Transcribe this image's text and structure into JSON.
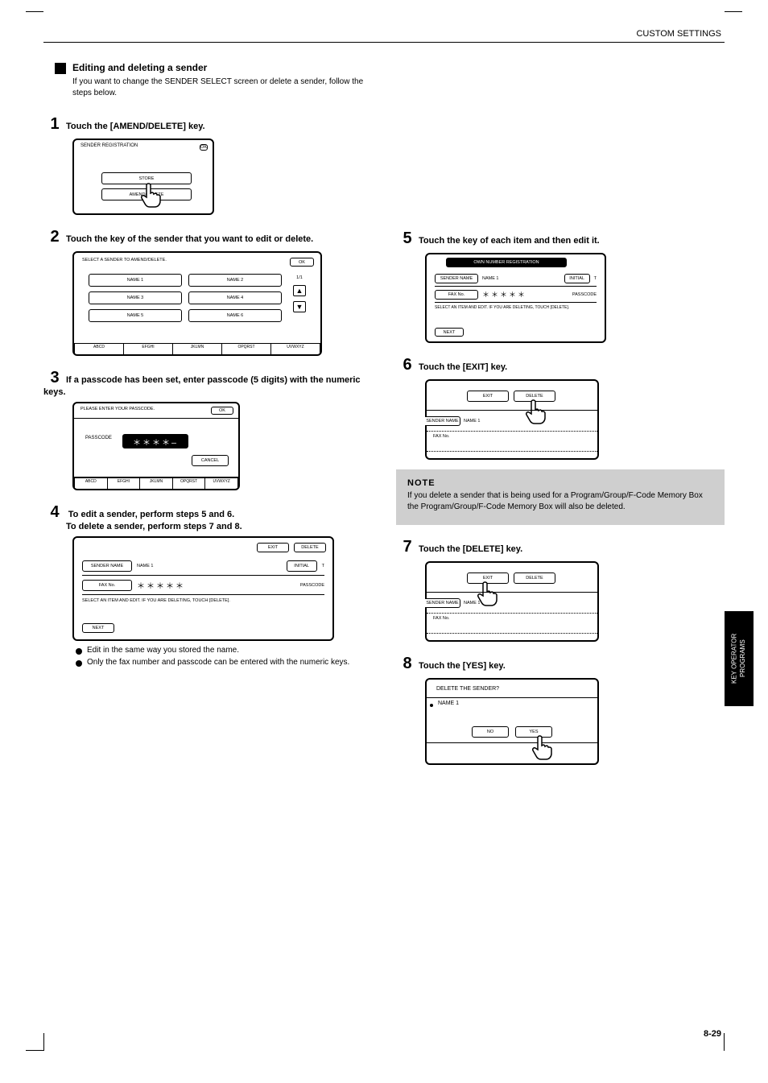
{
  "header": {
    "breadcrumb": "CUSTOM SETTINGS"
  },
  "side_tab": "KEY OPERATOR PROGRAMS",
  "footer_page": "8-29",
  "section": {
    "title": "Editing and deleting a sender",
    "intro": "If you want to change the SENDER SELECT screen or delete a sender, follow the steps below."
  },
  "steps": {
    "s1": {
      "num": "1",
      "txt": "Touch the [AMEND/DELETE] key."
    },
    "s2": {
      "num": "2",
      "txt": "Touch the key of the sender that you want to edit or delete."
    },
    "s3": {
      "num": "3",
      "txt": "If a passcode has been set, enter passcode (5 digits) with the numeric keys."
    },
    "s4_a": {
      "num": "4",
      "txt_a": "To edit a sender, perform steps 5 and 6.",
      "txt_b": "To delete a sender, perform steps 7 and 8."
    },
    "s5": {
      "num": "5",
      "txt": "Touch the key of each item and then edit it."
    },
    "s6": {
      "num": "6",
      "txt": "Touch the [EXIT] key."
    },
    "s7": {
      "num": "7",
      "txt": "Touch the [DELETE] key."
    },
    "s8": {
      "num": "8",
      "txt": "Touch the [YES] key."
    }
  },
  "panel1": {
    "ok": "OK",
    "row_label": "SENDER REGISTRATION",
    "opt1": "STORE",
    "opt2": "AMEND/DELETE"
  },
  "panel2": {
    "ok": "OK",
    "hint_top": "SELECT A SENDER TO AMEND/DELETE.",
    "items": [
      "NAME 1",
      "NAME 2",
      "NAME 3",
      "NAME 4",
      "NAME 5",
      "NAME 6"
    ],
    "page": "1/1",
    "tabs": [
      "ABCD",
      "EFGHI",
      "JKLMN",
      "OPQRST",
      "UVWXYZ"
    ]
  },
  "panel3": {
    "ok": "OK",
    "title": "PLEASE ENTER YOUR PASSCODE.",
    "passcode_label": "PASSCODE",
    "passcode_mask": "＊＊＊＊—",
    "cancel": "CANCEL",
    "tabs": [
      "ABCD",
      "EFGHI",
      "JKLMN",
      "OPQRST",
      "UVWXYZ"
    ]
  },
  "panel4": {
    "exit": "EXIT",
    "delete": "DELETE",
    "sender_name_label": "SENDER NAME",
    "sender_name_value": "NAME 1",
    "initial": "INITIAL",
    "initial_val": "T",
    "fax_label": "FAX No.",
    "fax_mask": "＊＊＊＊＊",
    "pass_label": "PASSCODE",
    "next": "NEXT",
    "hint": "SELECT AN ITEM AND EDIT. IF YOU ARE DELETING, TOUCH [DELETE]."
  },
  "bullets": {
    "b1": "Edit in the same way you stored the name.",
    "b2": "Only the fax number and passcode can be entered with the numeric keys."
  },
  "panel5": {
    "title": "OWN NUMBER REGISTRATION",
    "sender_name_label": "SENDER NAME",
    "sender_name_value": "NAME 1",
    "initial": "INITIAL",
    "initial_val": "T",
    "fax_label": "FAX No.",
    "fax_mask": "＊＊＊＊＊",
    "pass_label": "PASSCODE",
    "next": "NEXT",
    "hint": "SELECT AN ITEM AND EDIT. IF YOU ARE DELETING, TOUCH [DELETE]."
  },
  "panel6": {
    "exit": "EXIT",
    "delete": "DELETE",
    "sender_name_label": "SENDER NAME",
    "name_value": "NAME 1",
    "fax_label": "FAX No."
  },
  "note": {
    "title": "NOTE",
    "body": "If you delete a sender that is being used for a Program/Group/F-Code Memory Box the Program/Group/F-Code Memory Box will also be deleted."
  },
  "panel7": {
    "exit": "EXIT",
    "delete": "DELETE",
    "sender_name_label": "SENDER NAME",
    "name_value": "NAME 1",
    "fax_label": "FAX No."
  },
  "panel8": {
    "prompt": "DELETE THE SENDER?",
    "name_value": "NAME 1",
    "no": "NO",
    "yes": "YES"
  }
}
